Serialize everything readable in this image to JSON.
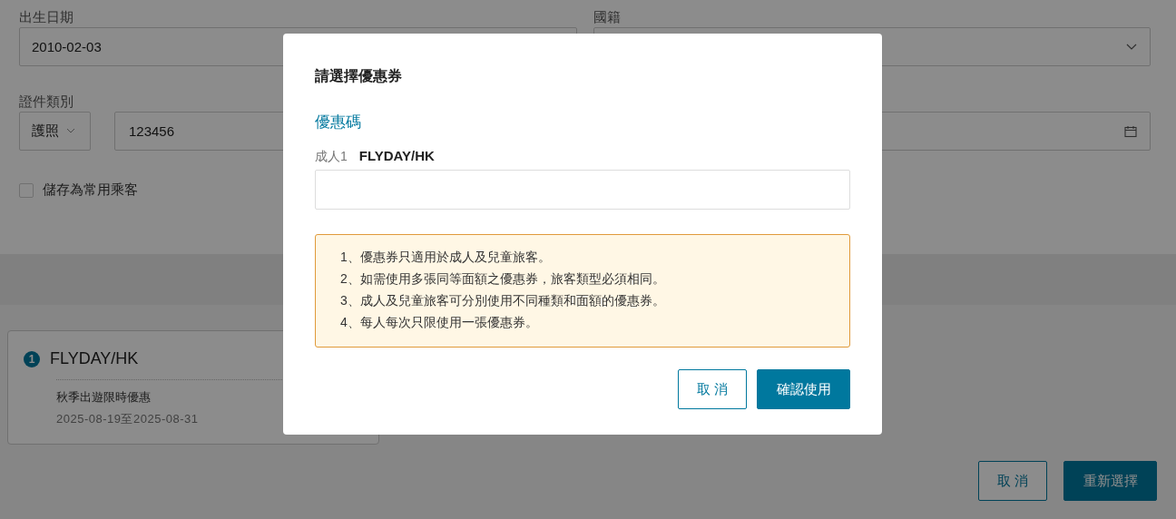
{
  "form": {
    "birth_date": {
      "label": "出生日期",
      "value": "2010-02-03"
    },
    "nationality": {
      "label": "國籍"
    },
    "document": {
      "label": "證件類別",
      "type": "護照",
      "number": "123456"
    },
    "save_passenger": {
      "label": "儲存為常用乘客",
      "checked": false
    }
  },
  "coupon_card": {
    "index": "1",
    "code": "FLYDAY/HK",
    "name": "秋季出遊限時優惠",
    "period": "2025-08-19至2025-08-31"
  },
  "footer_buttons": [
    {
      "label": "取 消",
      "kind": "secondary"
    },
    {
      "label": "重新選擇",
      "kind": "primary"
    }
  ],
  "dialog": {
    "title": "請選擇優惠券",
    "section": "優惠碼",
    "passenger_type": "成人1",
    "passenger_name": "FLYDAY/HK",
    "notes": [
      "1、優惠券只適用於成人及兒童旅客。",
      "2、如需使用多張同等面額之優惠券，旅客類型必須相同。",
      "3、成人及兒童旅客可分別使用不同種類和面額的優惠券。",
      "4、每人每次只限使用一張優惠券。"
    ],
    "buttons": [
      {
        "label": "取 消",
        "kind": "secondary"
      },
      {
        "label": "確認使用",
        "kind": "primary"
      }
    ]
  }
}
